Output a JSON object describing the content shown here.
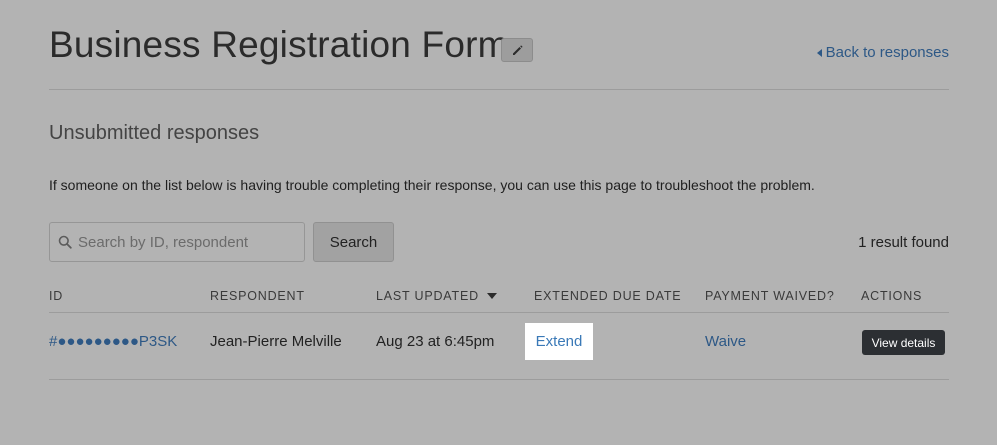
{
  "header": {
    "title": "Business Registration Form",
    "edit_icon": "pencil-icon",
    "back_link": "Back to responses"
  },
  "section": {
    "subtitle": "Unsubmitted responses",
    "description": "If someone on the list below is having trouble completing their response, you can use this page to troubleshoot the problem."
  },
  "search": {
    "placeholder": "Search by ID, respondent",
    "value": "",
    "button_label": "Search",
    "result_count": "1 result found"
  },
  "table": {
    "columns": [
      "ID",
      "RESPONDENT",
      "LAST UPDATED",
      "EXTENDED DUE DATE",
      "PAYMENT WAIVED?",
      "ACTIONS"
    ],
    "sort_column": "LAST UPDATED",
    "sort_direction": "descending",
    "rows": [
      {
        "id": "#●●●●●●●●●P3SK",
        "respondent": "Jean-Pierre Melville",
        "last_updated": "Aug 23 at 6:45pm",
        "extend_label": "Extend",
        "waive_label": "Waive",
        "action_label": "View details"
      }
    ]
  },
  "colors": {
    "background": "#b3b3b3",
    "link": "#2d5886",
    "highlight_link": "#3a79b7",
    "dark_button": "#2c2f33"
  }
}
